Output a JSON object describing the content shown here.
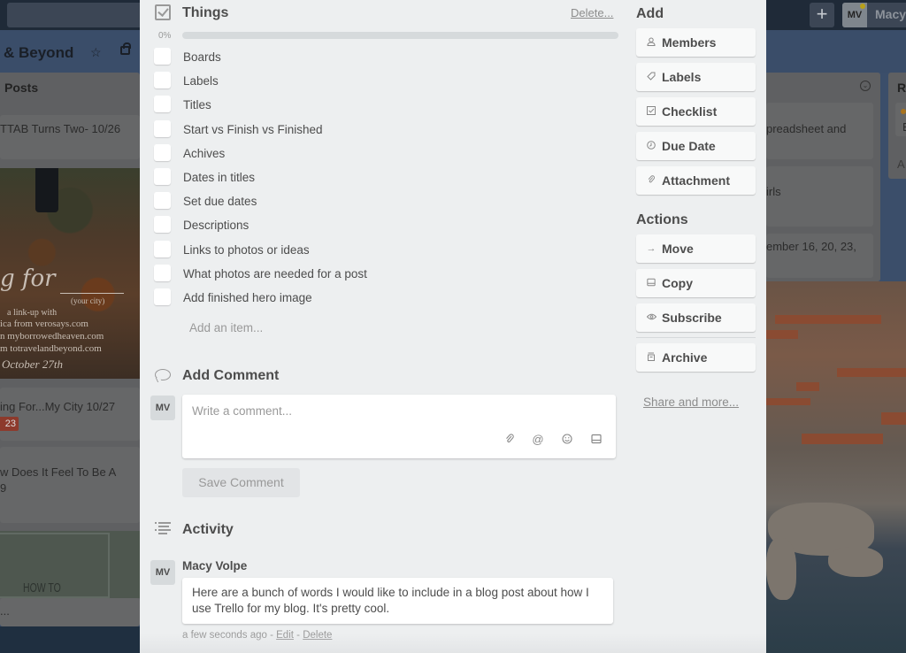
{
  "topbar": {
    "add_label": "+",
    "member_initials": "MV",
    "member_name": "Macy"
  },
  "board": {
    "title": "& Beyond",
    "lists": {
      "left": {
        "title": "Posts",
        "cards": [
          {
            "text": "TTAB Turns Two- 10/26"
          },
          {
            "text": "ing For...My City 10/27",
            "badge": "23",
            "badge_color": "#b04632"
          },
          {
            "text": "w Does It Feel To Be A\n9"
          },
          {
            "text": "..."
          }
        ],
        "image_text": {
          "script": "g for",
          "your_city": "(your city)",
          "link_up": "a link-up with",
          "line1": "ica from verosays.com",
          "line2": "n myborrowedheaven.com",
          "line3": "m totravelandbeyond.com",
          "date": "October 27th"
        },
        "howto_text": "HOW TO"
      },
      "middle": {
        "cards": [
          {
            "text": "preadsheet and"
          },
          {
            "text": "irls"
          },
          {
            "text": "ember 16, 20, 23,"
          }
        ]
      },
      "right": {
        "title": "R",
        "card_text": "E",
        "add_text": "A"
      }
    }
  },
  "modal": {
    "checklist": {
      "title": "Things",
      "delete_label": "Delete...",
      "progress_percent_label": "0%",
      "progress": 0,
      "items": [
        {
          "label": "Boards",
          "checked": false
        },
        {
          "label": "Labels",
          "checked": false
        },
        {
          "label": "Titles",
          "checked": false
        },
        {
          "label": "Start vs Finish vs Finished",
          "checked": false
        },
        {
          "label": "Achives",
          "checked": false
        },
        {
          "label": "Dates in titles",
          "checked": false
        },
        {
          "label": "Set due dates",
          "checked": false
        },
        {
          "label": "Descriptions",
          "checked": false
        },
        {
          "label": "Links to photos or ideas",
          "checked": false
        },
        {
          "label": "What photos are needed for a post",
          "checked": false
        },
        {
          "label": "Add finished hero image",
          "checked": false
        }
      ],
      "add_item_placeholder": "Add an item..."
    },
    "comment": {
      "title": "Add Comment",
      "avatar_initials": "MV",
      "placeholder": "Write a comment...",
      "save_label": "Save Comment"
    },
    "activity": {
      "title": "Activity",
      "entries": [
        {
          "avatar_initials": "MV",
          "author": "Macy Volpe",
          "text": "Here are a bunch of words I would like to include in a blog post about how I use Trello for my blog. It's pretty cool.",
          "time": "a few seconds ago",
          "edit_label": "Edit",
          "delete_label": "Delete"
        }
      ]
    },
    "sidebar": {
      "add_heading": "Add",
      "add_buttons": [
        {
          "label": "Members",
          "icon": "person-icon"
        },
        {
          "label": "Labels",
          "icon": "tag-icon"
        },
        {
          "label": "Checklist",
          "icon": "checklist-icon"
        },
        {
          "label": "Due Date",
          "icon": "clock-icon"
        },
        {
          "label": "Attachment",
          "icon": "paperclip-icon"
        }
      ],
      "actions_heading": "Actions",
      "action_buttons": [
        {
          "label": "Move",
          "icon": "arrow-right-icon"
        },
        {
          "label": "Copy",
          "icon": "copy-icon"
        },
        {
          "label": "Subscribe",
          "icon": "eye-icon"
        },
        {
          "label": "Archive",
          "icon": "archive-icon"
        }
      ],
      "share_label": "Share and more..."
    }
  }
}
